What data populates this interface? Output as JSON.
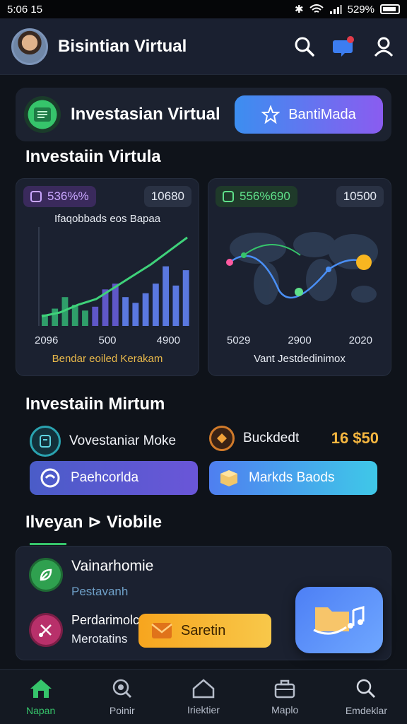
{
  "status": {
    "time": "5:​06 15",
    "battery": "529%"
  },
  "appbar": {
    "title": "Bisintian Virtual"
  },
  "hero": {
    "title": "Investasian Virtual",
    "button_label": "BantiMada"
  },
  "section1": {
    "title": "Investaiin Virtula"
  },
  "card_left": {
    "pill_left": "536%%",
    "pill_right": "10680",
    "chart_title": "Ifaqobbads eos Bapaa",
    "x_labels": [
      "2096",
      "500",
      "4900"
    ],
    "caption": "Bendar eoiled Kerakam",
    "caption_color": "#e8b84a"
  },
  "card_right": {
    "pill_left": "556%690",
    "pill_right": "10500",
    "x_labels": [
      "5029",
      "2900",
      "2020"
    ],
    "caption": "Vant Jestdedinimox"
  },
  "section2": {
    "title": "Investaiin Mirtum",
    "item_left_label": "Vovestaniar Moke",
    "item_right_label": "Buckdedt",
    "item_right_value": "16 $50",
    "btn_left_label": "Paehcorlda",
    "btn_right_label": "Markds Baods"
  },
  "section3": {
    "title": "Ilveyan ⊳ Viobile"
  },
  "list": [
    {
      "title": "Vainarhomie",
      "subtitle": "Pestavanh"
    },
    {
      "title": "Perdarimolc",
      "subtitle": "Merotatins"
    }
  ],
  "orange_button": {
    "label": "Saretin"
  },
  "nav": [
    {
      "label": "Napan",
      "icon": "home-icon"
    },
    {
      "label": "Poinir",
      "icon": "search-magnify-icon"
    },
    {
      "label": "Iriektier",
      "icon": "house-outline-icon"
    },
    {
      "label": "Maplo",
      "icon": "briefcase-icon"
    },
    {
      "label": "Emdeklar",
      "icon": "search-icon"
    }
  ],
  "colors": {
    "accent_green": "#36c46b",
    "accent_blue": "#3c8ef0",
    "accent_purple": "#8a5cf0",
    "accent_orange": "#f7a51e"
  },
  "chart_data": [
    {
      "type": "bar",
      "title": "Ifaqobbads eos Bapaa",
      "categories": [
        "1",
        "2",
        "3",
        "4",
        "5",
        "6",
        "7",
        "8",
        "9",
        "10",
        "11",
        "12",
        "13",
        "14",
        "15"
      ],
      "series": [
        {
          "values": [
            12,
            18,
            30,
            22,
            16,
            20,
            38,
            44,
            30,
            24,
            34,
            44,
            62,
            42,
            58
          ]
        }
      ],
      "trend": [
        10,
        14,
        22,
        28,
        40,
        52,
        64,
        78,
        92
      ],
      "x_tick_labels": [
        "2096",
        "500",
        "4900"
      ],
      "ylim": [
        0,
        100
      ]
    }
  ]
}
